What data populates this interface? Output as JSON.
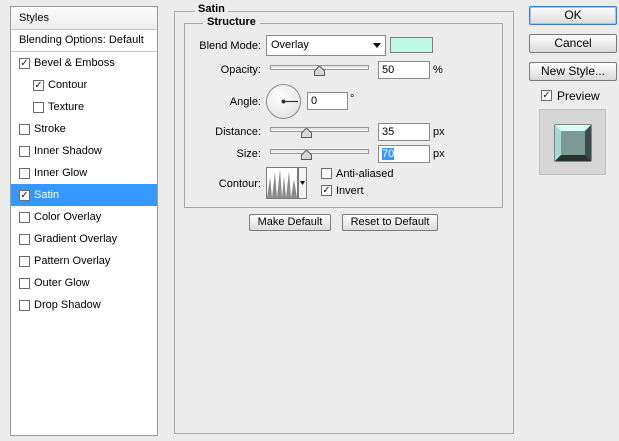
{
  "styles_panel": {
    "header": "Styles",
    "blending_options": "Blending Options: Default",
    "items": [
      {
        "label": "Bevel & Emboss",
        "checked": true,
        "sub": false,
        "selected": false
      },
      {
        "label": "Contour",
        "checked": true,
        "sub": true,
        "selected": false
      },
      {
        "label": "Texture",
        "checked": false,
        "sub": true,
        "selected": false
      },
      {
        "label": "Stroke",
        "checked": false,
        "sub": false,
        "selected": false
      },
      {
        "label": "Inner Shadow",
        "checked": false,
        "sub": false,
        "selected": false
      },
      {
        "label": "Inner Glow",
        "checked": false,
        "sub": false,
        "selected": false
      },
      {
        "label": "Satin",
        "checked": true,
        "sub": false,
        "selected": true
      },
      {
        "label": "Color Overlay",
        "checked": false,
        "sub": false,
        "selected": false
      },
      {
        "label": "Gradient Overlay",
        "checked": false,
        "sub": false,
        "selected": false
      },
      {
        "label": "Pattern Overlay",
        "checked": false,
        "sub": false,
        "selected": false
      },
      {
        "label": "Outer Glow",
        "checked": false,
        "sub": false,
        "selected": false
      },
      {
        "label": "Drop Shadow",
        "checked": false,
        "sub": false,
        "selected": false
      }
    ]
  },
  "satin": {
    "title": "Satin",
    "structure_title": "Structure",
    "blend_mode": {
      "label": "Blend Mode:",
      "value": "Overlay",
      "color": "#bff8e6"
    },
    "opacity": {
      "label": "Opacity:",
      "value": "50",
      "unit": "%",
      "percent": 50
    },
    "angle": {
      "label": "Angle:",
      "value": "0",
      "unit": "°"
    },
    "distance": {
      "label": "Distance:",
      "value": "35",
      "unit": "px",
      "percent": 35
    },
    "size": {
      "label": "Size:",
      "value": "70",
      "unit": "px",
      "percent": 35
    },
    "contour": {
      "label": "Contour:"
    },
    "anti_aliased": {
      "label": "Anti-aliased",
      "checked": false
    },
    "invert": {
      "label": "Invert",
      "checked": true
    },
    "make_default": "Make Default",
    "reset_default": "Reset to Default"
  },
  "actions": {
    "ok": "OK",
    "cancel": "Cancel",
    "new_style": "New Style...",
    "preview_label": "Preview",
    "preview_checked": true
  },
  "icons": {
    "check": "checkmark-icon",
    "dropdown": "chevron-down-icon",
    "slider_thumb": "slider-thumb-icon",
    "angle_dial": "angle-dial-icon",
    "contour_preview": "contour-curve-icon",
    "style_preview": "style-preview-icon"
  }
}
